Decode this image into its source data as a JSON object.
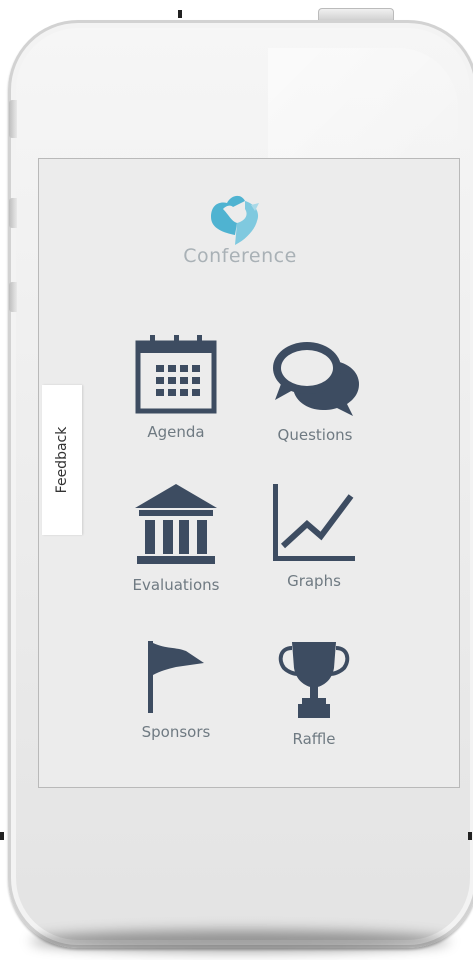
{
  "app": {
    "name": "Conference",
    "feedback_label": "Feedback"
  },
  "menu": [
    {
      "id": "agenda",
      "label": "Agenda",
      "icon": "calendar-icon"
    },
    {
      "id": "questions",
      "label": "Questions",
      "icon": "speech-bubbles-icon"
    },
    {
      "id": "evaluations",
      "label": "Evaluations",
      "icon": "institution-building-icon"
    },
    {
      "id": "graphs",
      "label": "Graphs",
      "icon": "line-graph-icon"
    },
    {
      "id": "sponsors",
      "label": "Sponsors",
      "icon": "flag-icon"
    },
    {
      "id": "raffle",
      "label": "Raffle",
      "icon": "trophy-icon"
    }
  ],
  "colors": {
    "icon": "#3d4c61",
    "logo": "#4fb3d1",
    "label": "#6f7a82",
    "logo_text": "#a9b1b6"
  }
}
